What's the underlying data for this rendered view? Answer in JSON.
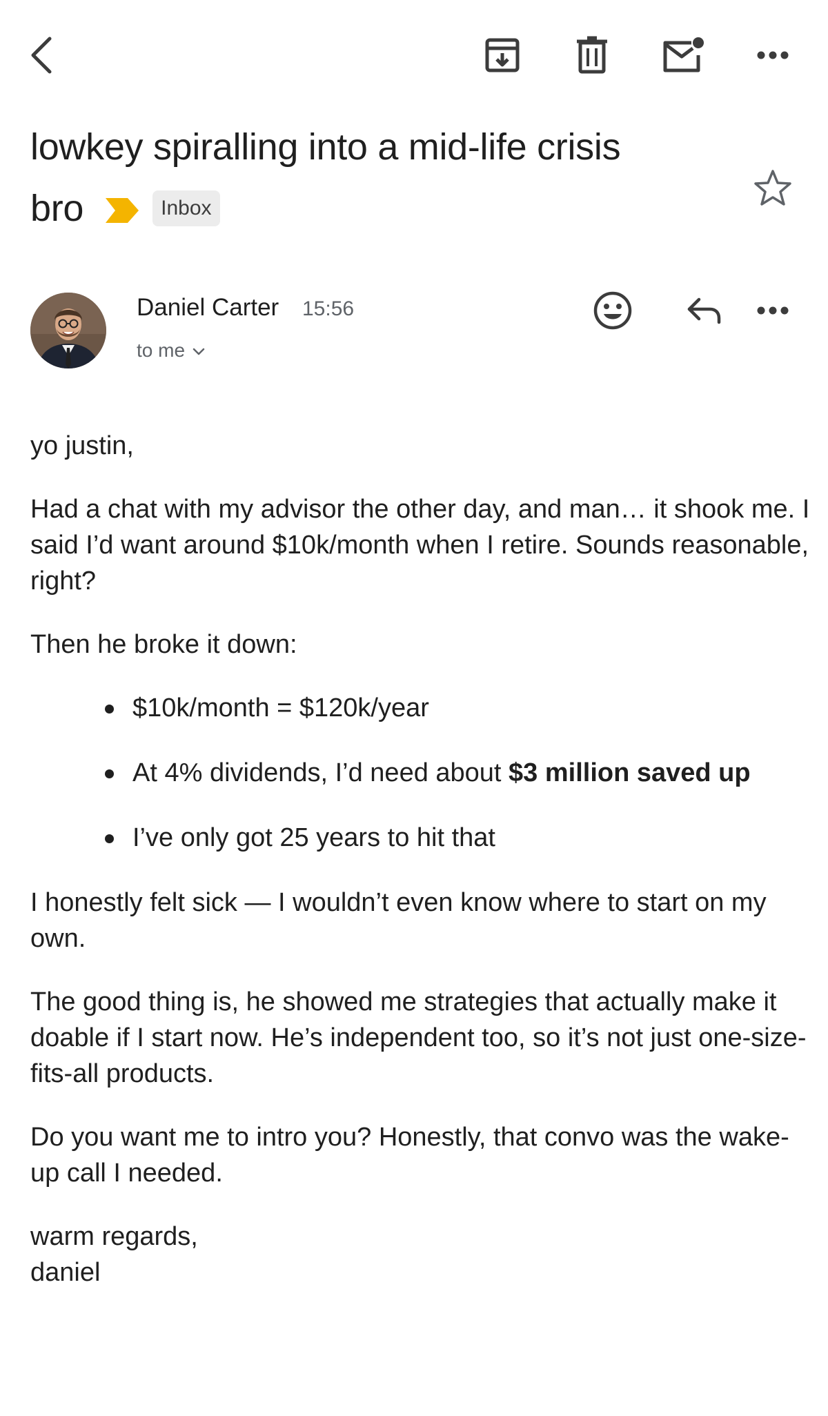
{
  "toolbar": {
    "icons": [
      "back-arrow-icon",
      "archive-icon",
      "delete-icon",
      "mark-unread-icon",
      "more-icon"
    ]
  },
  "subject": {
    "line1": "lowkey spiralling into a mid-life crisis",
    "line2": "bro",
    "label": "Inbox",
    "importance_color": "#F4B400"
  },
  "message": {
    "sender": "Daniel Carter",
    "time": "15:56",
    "to": "to me",
    "icons": [
      "emoji-icon",
      "reply-icon",
      "more-icon"
    ]
  },
  "body": {
    "greeting": "yo justin,",
    "p1": "Had a chat with my advisor the other day, and man… it shook me. I said I’d want around $10k/month when I retire. Sounds reasonable, right?",
    "p2": "Then he broke it down:",
    "bullets": [
      {
        "text": "$10k/month = $120k/year"
      },
      {
        "prefix": "At 4% dividends, I’d need about ",
        "bold": "$3 million saved up"
      },
      {
        "text": "I’ve only got 25 years to hit that"
      }
    ],
    "p3": "I honestly felt sick — I wouldn’t even know where to start on my own.",
    "p4": "The good thing is, he showed me strategies that actually make it doable if I start now. He’s independent too, so it’s not just one-size-fits-all products.",
    "p5": "Do you want me to intro you? Honestly, that convo was the wake-up call I needed.",
    "signoff": "warm regards,",
    "signature": "daniel"
  }
}
